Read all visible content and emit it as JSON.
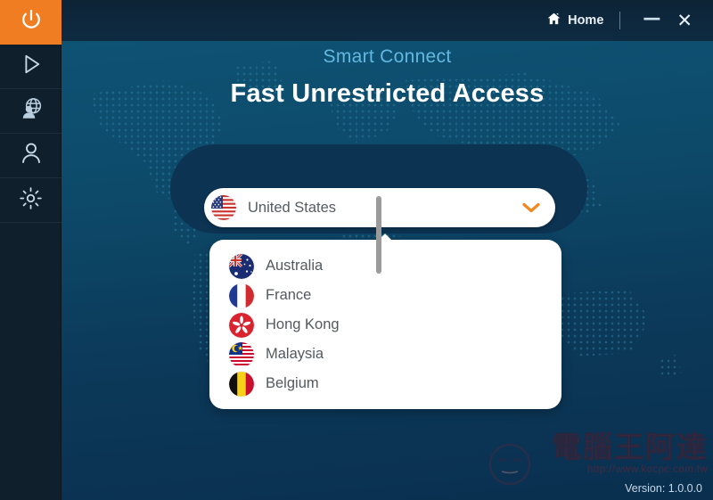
{
  "window": {
    "titlebar": {
      "home_label": "Home",
      "home_icon": "house-icon",
      "minimize_label": "—",
      "close_label": "✕"
    },
    "version_label": "Version:  1.0.0.0"
  },
  "sidebar": {
    "items": [
      {
        "name": "power",
        "icon": "power-icon",
        "active": true
      },
      {
        "name": "connect",
        "icon": "play-triangle-icon",
        "active": false
      },
      {
        "name": "locations",
        "icon": "globe-user-icon",
        "active": false
      },
      {
        "name": "account",
        "icon": "person-icon",
        "active": false
      },
      {
        "name": "settings",
        "icon": "gear-icon",
        "active": false
      }
    ]
  },
  "main": {
    "subtitle": "Smart Connect",
    "title": "Fast Unrestricted Access",
    "selector": {
      "value": "United States",
      "flag": "us-flag-icon",
      "chevron": "chevron-down-icon"
    },
    "dropdown": {
      "options": [
        {
          "label": "Australia",
          "flag": "au-flag-icon"
        },
        {
          "label": "France",
          "flag": "fr-flag-icon"
        },
        {
          "label": "Hong Kong",
          "flag": "hk-flag-icon"
        },
        {
          "label": "Malaysia",
          "flag": "my-flag-icon"
        },
        {
          "label": "Belgium",
          "flag": "be-flag-icon"
        }
      ]
    }
  },
  "watermark": {
    "text": "電腦王阿達",
    "url": "http://www.kocpc.com.tw"
  },
  "colors": {
    "accent_orange": "#f07d21",
    "sidebar_dark": "#101f2c",
    "stage_top": "#0e5274",
    "stage_bottom": "#0a2f4f",
    "titlebar": "#0e2b42",
    "subtitle_blue": "#62b8df",
    "plate_navy": "#0c3352"
  }
}
